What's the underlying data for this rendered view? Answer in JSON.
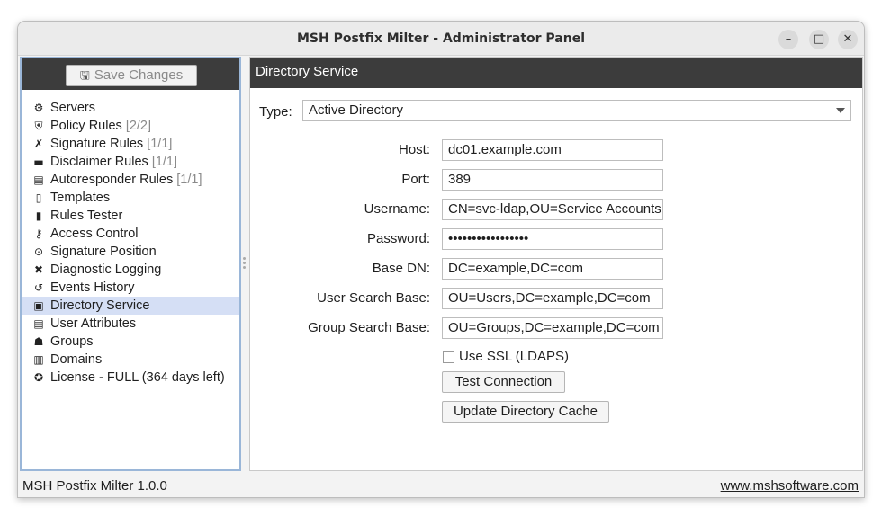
{
  "window": {
    "title": "MSH Postfix Milter - Administrator Panel",
    "minimize_glyph": "–",
    "maximize_glyph": "□",
    "close_glyph": "✕"
  },
  "sidebar": {
    "save_button": {
      "label": "Save Changes",
      "icon": "save-icon",
      "enabled": false
    },
    "items": [
      {
        "label": "Servers",
        "count": "",
        "icon": "servers-icon",
        "glyph": "⚙"
      },
      {
        "label": "Policy Rules",
        "count": "[2/2]",
        "icon": "shield-icon",
        "glyph": "⛨"
      },
      {
        "label": "Signature Rules",
        "count": "[1/1]",
        "icon": "signature-icon",
        "glyph": "✗"
      },
      {
        "label": "Disclaimer Rules",
        "count": "[1/1]",
        "icon": "disclaimer-icon",
        "glyph": "▬"
      },
      {
        "label": "Autoresponder Rules",
        "count": "[1/1]",
        "icon": "autoresponder-icon",
        "glyph": "▤"
      },
      {
        "label": "Templates",
        "count": "",
        "icon": "templates-icon",
        "glyph": "▯"
      },
      {
        "label": "Rules Tester",
        "count": "",
        "icon": "tester-icon",
        "glyph": "▮"
      },
      {
        "label": "Access Control",
        "count": "",
        "icon": "key-icon",
        "glyph": "⚷"
      },
      {
        "label": "Signature Position",
        "count": "",
        "icon": "location-pin-icon",
        "glyph": "⊙"
      },
      {
        "label": "Diagnostic Logging",
        "count": "",
        "icon": "tools-icon",
        "glyph": "✖"
      },
      {
        "label": "Events History",
        "count": "",
        "icon": "history-icon",
        "glyph": "↺"
      },
      {
        "label": "Directory Service",
        "count": "",
        "icon": "directory-icon",
        "glyph": "▣",
        "selected": true
      },
      {
        "label": "User Attributes",
        "count": "",
        "icon": "id-card-icon",
        "glyph": "▤"
      },
      {
        "label": "Groups",
        "count": "",
        "icon": "groups-icon",
        "glyph": "☗"
      },
      {
        "label": "Domains",
        "count": "",
        "icon": "domains-icon",
        "glyph": "▥"
      },
      {
        "label": "License - FULL (364 days left)",
        "count": "",
        "icon": "license-icon",
        "glyph": "✪"
      }
    ]
  },
  "content": {
    "header": "Directory Service",
    "type_label": "Type:",
    "type_value": "Active Directory",
    "fields": [
      {
        "label": "Host:",
        "value": "dc01.example.com"
      },
      {
        "label": "Port:",
        "value": "389"
      },
      {
        "label": "Username:",
        "value": "CN=svc-ldap,OU=Service Accounts"
      },
      {
        "label": "Password:",
        "value": "•••••••••••••••••"
      },
      {
        "label": "Base DN:",
        "value": "DC=example,DC=com"
      },
      {
        "label": "User Search Base:",
        "value": "OU=Users,DC=example,DC=com"
      },
      {
        "label": "Group Search Base:",
        "value": "OU=Groups,DC=example,DC=com"
      }
    ],
    "use_ssl_label": "Use SSL (LDAPS)",
    "use_ssl_checked": false,
    "test_button": "Test Connection",
    "update_button": "Update Directory Cache"
  },
  "statusbar": {
    "version": "MSH Postfix Milter 1.0.0",
    "website": "www.mshsoftware.com"
  }
}
